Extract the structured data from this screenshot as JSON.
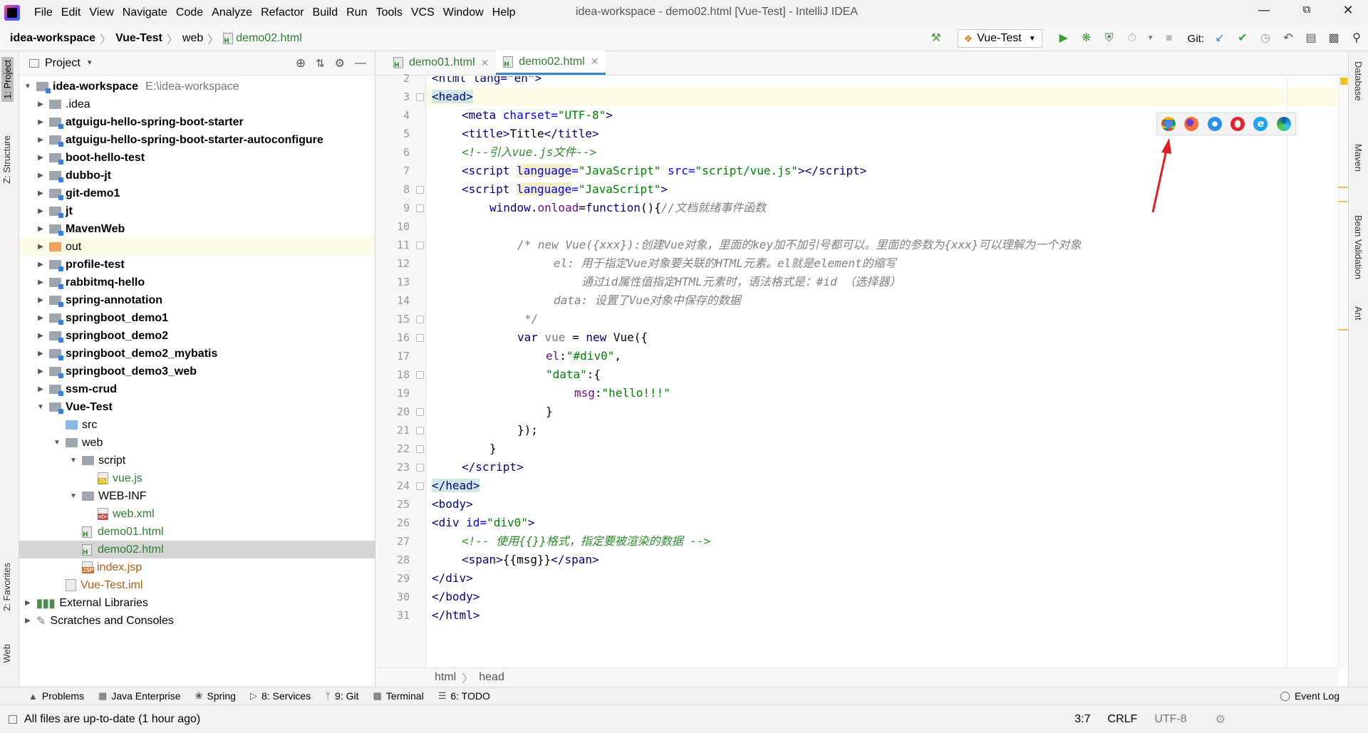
{
  "app": {
    "title": "idea-workspace - demo02.html [Vue-Test] - IntelliJ IDEA",
    "menu": [
      "File",
      "Edit",
      "View",
      "Navigate",
      "Code",
      "Analyze",
      "Refactor",
      "Build",
      "Run",
      "Tools",
      "VCS",
      "Window",
      "Help"
    ]
  },
  "breadcrumb": [
    "idea-workspace",
    "Vue-Test",
    "web",
    "demo02.html"
  ],
  "toolbar": {
    "run_config": "Vue-Test",
    "git_label": "Git:"
  },
  "left_strip": {
    "project": "1: Project",
    "structure": "Z: Structure",
    "favorites": "2: Favorites",
    "web": "Web"
  },
  "right_strip": {
    "database": "Database",
    "maven": "Maven",
    "bean": "Bean Validation",
    "ant": "Ant"
  },
  "project_panel": {
    "title": "Project",
    "root_name": "idea-workspace",
    "root_path": "E:\\idea-workspace",
    "items": [
      ".idea",
      "atguigu-hello-spring-boot-starter",
      "atguigu-hello-spring-boot-starter-autoconfigure",
      "boot-hello-test",
      "dubbo-jt",
      "git-demo1",
      "jt",
      "MavenWeb",
      "out",
      "profile-test",
      "rabbitmq-hello",
      "spring-annotation",
      "springboot_demo1",
      "springboot_demo2",
      "springboot_demo2_mybatis",
      "springboot_demo3_web",
      "ssm-crud",
      "Vue-Test",
      "src",
      "web",
      "script",
      "vue.js",
      "WEB-INF",
      "web.xml",
      "demo01.html",
      "demo02.html",
      "index.jsp",
      "Vue-Test.iml",
      "External Libraries",
      "Scratches and Consoles"
    ]
  },
  "tabs": [
    {
      "label": "demo01.html"
    },
    {
      "label": "demo02.html"
    }
  ],
  "code": {
    "line_numbers": [
      "2",
      "3",
      "4",
      "5",
      "6",
      "7",
      "8",
      "9",
      "10",
      "11",
      "12",
      "13",
      "14",
      "15",
      "16",
      "17",
      "18",
      "19",
      "20",
      "21",
      "22",
      "23",
      "24",
      "25",
      "26",
      "27",
      "28",
      "29",
      "30",
      "31"
    ],
    "l2": "<html lang=\"en\">",
    "l3": "<head>",
    "l4a": "<meta ",
    "l4b": "charset=",
    "l4c": "\"UTF-8\"",
    "l4d": ">",
    "l5a": "<title>",
    "l5b": "Title",
    "l5c": "</title>",
    "l6": "<!--引入vue.js文件-->",
    "l7a": "<script ",
    "l7b": "language",
    "l7c": "=",
    "l7d": "\"JavaScript\"",
    "l7e": " src=",
    "l7f": "\"script/vue.js\"",
    "l7g": "></",
    "l7h": "script",
    ">": ">",
    "l8a": "<script ",
    "l8b": "language",
    "l8c": "=",
    "l8d": "\"JavaScript\"",
    "l8e": ">",
    "l9a": "window.",
    "l9b": "onload",
    "l9c": "=",
    "l9d": "function",
    "l9e": "(){",
    "l9f": "//文档就绪事件函数",
    "l11": "/* new Vue({xxx}):创建Vue对象，里面的key加不加引号都可以。里面的参数为{xxx}可以理解为一个对象",
    "l12": "el: 用于指定Vue对象要关联的HTML元素。el就是element的缩写",
    "l13": "通过id属性值指定HTML元素时，语法格式是：#id （选择器）",
    "l14": "data: 设置了Vue对象中保存的数据",
    "l15": "*/",
    "l16a": "var ",
    "l16b": "vue ",
    "l16c": "= ",
    "l16d": "new ",
    "l16e": "Vue({",
    "l17a": "el",
    ":": ":",
    "l17b": "\"#div0\"",
    "l17c": ",",
    "l18a": "\"data\"",
    "l18b": ":{",
    "l19a": "msg",
    ":2": ":",
    "l19b": "\"hello!!!\"",
    "l20": "}",
    "l21": "});",
    "l22": "}",
    "l23a": "</",
    "l23b": "script",
    "l23c": ">",
    "l24": "</head>",
    "l25": "<body>",
    "l26a": "<div ",
    "l26b": "id=",
    "l26c": "\"div0\"",
    "l26d": ">",
    "l27": "<!-- 使用{{}}格式，指定要被渲染的数据 -->",
    "l28a": "<span>",
    "l28b": "{{msg}}",
    "l28c": "</span>",
    "l29": "</div>",
    "l30": "</body>",
    "l31": "</html>"
  },
  "editor_breadcrumb": [
    "html",
    "head"
  ],
  "bottom_tabs": [
    "Problems",
    "Java Enterprise",
    "Spring",
    "8: Services",
    "9: Git",
    "Terminal",
    "6: TODO"
  ],
  "event_log": "Event Log",
  "status": {
    "message": "All files are up-to-date (1 hour ago)",
    "position": "3:7",
    "line_sep": "CRLF",
    "encoding": "UTF-8"
  },
  "colors": {
    "accent": "#4083c9",
    "selection": "#d5d5d5",
    "current_line": "#fdfbe6"
  }
}
